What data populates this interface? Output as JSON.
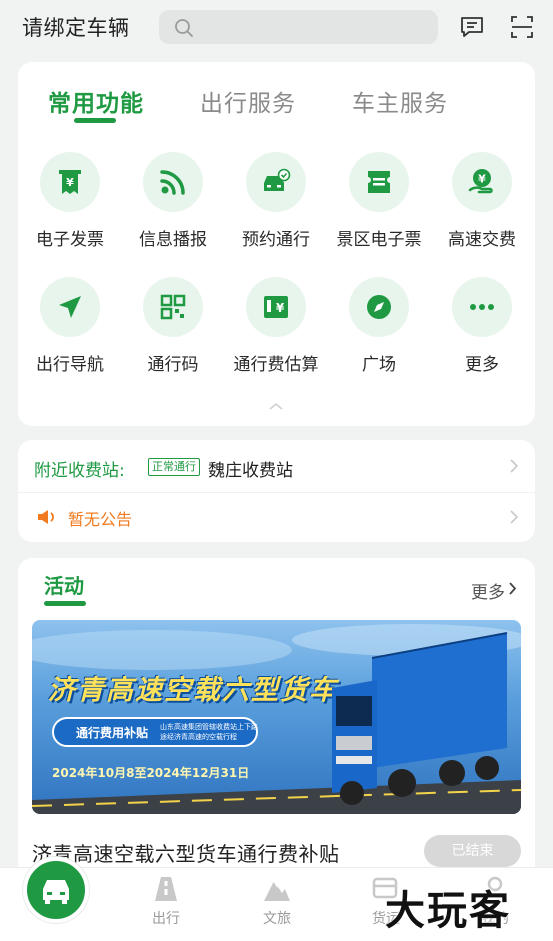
{
  "header": {
    "title": "请绑定车辆",
    "search_placeholder": ""
  },
  "function_tabs": [
    {
      "label": "常用功能",
      "active": true
    },
    {
      "label": "出行服务",
      "active": false
    },
    {
      "label": "车主服务",
      "active": false
    }
  ],
  "function_items": [
    {
      "label": "电子发票",
      "icon": "invoice-icon"
    },
    {
      "label": "信息播报",
      "icon": "broadcast-icon"
    },
    {
      "label": "预约通行",
      "icon": "car-check-icon"
    },
    {
      "label": "景区电子票",
      "icon": "ticket-icon"
    },
    {
      "label": "高速交费",
      "icon": "yuan-hand-icon"
    },
    {
      "label": "出行导航",
      "icon": "navigation-arrow-icon"
    },
    {
      "label": "通行码",
      "icon": "qr-code-icon"
    },
    {
      "label": "通行费估算",
      "icon": "fee-estimate-icon"
    },
    {
      "label": "广场",
      "icon": "compass-icon"
    },
    {
      "label": "更多",
      "icon": "more-dots-icon"
    }
  ],
  "nearby": {
    "label": "附近收费站:",
    "badge": "正常通行",
    "station": "魏庄收费站"
  },
  "notice": {
    "text": "暂无公告"
  },
  "activity": {
    "title": "活动",
    "more_label": "更多",
    "banner_headline": "济青高速空载六型货车",
    "banner_pill_label": "通行费用补贴",
    "banner_pill_desc": "山东高速集团管辖收费站上下路途经济青高速的空载行程",
    "banner_date": "2024年10月8至2024年12月31日",
    "name": "济青高速空载六型货车通行费补贴",
    "status": "已结束"
  },
  "bottom_nav": [
    {
      "label": "出行",
      "icon": "road-icon"
    },
    {
      "label": "文旅",
      "icon": "travel-icon"
    },
    {
      "label": "货运",
      "icon": "freight-icon"
    },
    {
      "label": "我的",
      "icon": "profile-icon"
    }
  ],
  "watermark": "大玩客",
  "colors": {
    "primary_green": "#1f9a43",
    "icon_bg": "#e8f5ec",
    "notice_orange": "#f07a1d"
  }
}
